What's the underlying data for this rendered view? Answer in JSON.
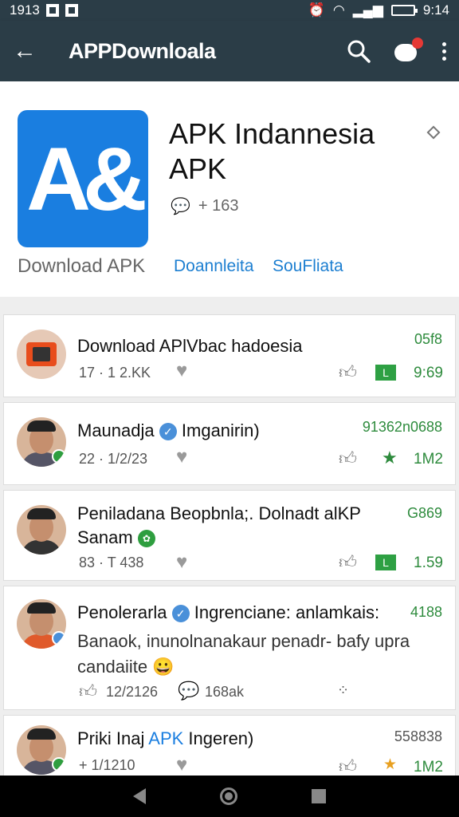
{
  "status_bar": {
    "time": "1913",
    "clock": "9:14"
  },
  "app_bar": {
    "title": "APPDownloala"
  },
  "header": {
    "app_name": "APK Indannesia APK",
    "meta_count": "+ 163",
    "download_label": "Download APK",
    "link1": "Doannleita",
    "link2": "SouFliata"
  },
  "items": [
    {
      "title": "Download APlVbac hadoesia",
      "count": "17 · 1 2.KK",
      "top_right": "05f8",
      "right_value": "9:69"
    },
    {
      "title": "Maunadja",
      "title_suffix": "Imganirin)",
      "count": "22 · 1/2/23",
      "top_right": "91362n0688",
      "right_value": "1M2"
    },
    {
      "title": "Peniladana Beopbnla;. Dolnadt alKP",
      "title_line2": "Sanam",
      "count": "83 · T 438",
      "top_right": "G869",
      "right_value": "1.59"
    },
    {
      "title": "Penolerarla",
      "title_suffix": "Ingrenciane: anlamkais:",
      "body": "Banaok, inunolnanakaur penadr- bafy upra",
      "body2": "candaiite",
      "likes": "12/2126",
      "comments": "168ak",
      "top_right": "4188"
    },
    {
      "title": "Priki Inaj",
      "title_mid": "APK",
      "title_suffix": "Ingeren)",
      "count": "+ 1/1210",
      "top_right": "558838",
      "right_value": "1M2"
    }
  ]
}
